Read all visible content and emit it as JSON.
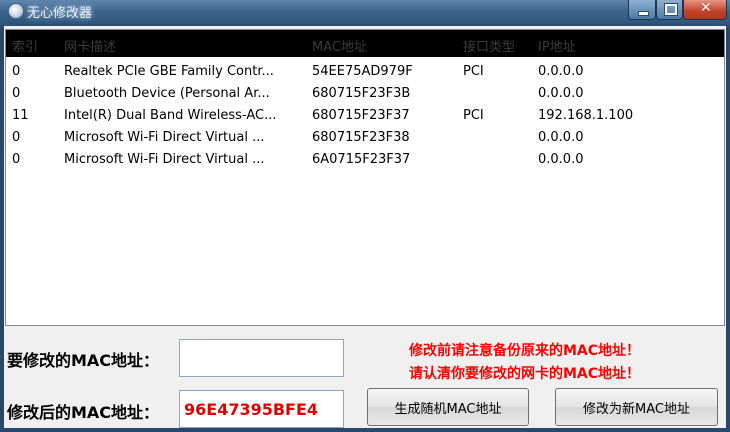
{
  "window": {
    "title": "无心修改器",
    "icons": {
      "app": "app-icon",
      "minimize": "minimize-icon",
      "maximize": "maximize-icon",
      "close": "close-icon"
    }
  },
  "adapters": {
    "columns": [
      "索引",
      "网卡描述",
      "MAC地址",
      "接口类型",
      "IP地址"
    ],
    "rows": [
      {
        "index": "0",
        "description": "Realtek PCIe GBE Family Contr...",
        "mac": "54EE75AD979F",
        "type": "PCI",
        "ip": "0.0.0.0"
      },
      {
        "index": "0",
        "description": "Bluetooth Device (Personal Ar...",
        "mac": "680715F23F3B",
        "type": "",
        "ip": "0.0.0.0"
      },
      {
        "index": "11",
        "description": "Intel(R) Dual Band Wireless-AC...",
        "mac": "680715F23F37",
        "type": "PCI",
        "ip": "192.168.1.100"
      },
      {
        "index": "0",
        "description": "Microsoft Wi-Fi Direct Virtual ...",
        "mac": "680715F23F38",
        "type": "",
        "ip": "0.0.0.0"
      },
      {
        "index": "0",
        "description": "Microsoft Wi-Fi Direct Virtual ...",
        "mac": "6A0715F23F37",
        "type": "",
        "ip": "0.0.0.0"
      }
    ]
  },
  "form": {
    "target_label": "要修改的MAC地址：",
    "target_value": "",
    "new_label": "修改后的MAC地址：",
    "new_value": "96E47395BFE4",
    "warning_line1": "修改前请注意备份原来的MAC地址！",
    "warning_line2": "请认清你要修改的网卡的MAC地址！",
    "random_button": "生成随机MAC地址",
    "apply_button": "修改为新MAC地址"
  },
  "colors": {
    "warning": "#ff0000",
    "new_mac_text": "#e00000",
    "header_bg": "#000000"
  }
}
